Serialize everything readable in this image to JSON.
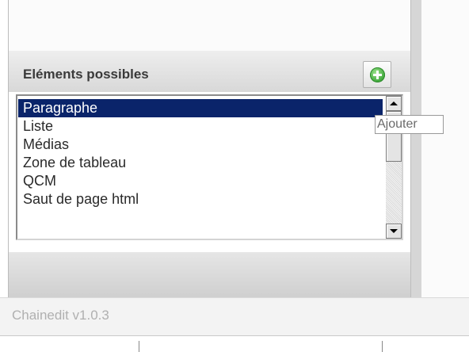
{
  "panel": {
    "header_title": "Eléments possibles",
    "add_button_icon": "plus-circle-icon",
    "list": {
      "selected_index": 0,
      "items": [
        {
          "label": "Paragraphe"
        },
        {
          "label": "Liste"
        },
        {
          "label": "Médias"
        },
        {
          "label": "Zone de tableau"
        },
        {
          "label": "QCM"
        },
        {
          "label": "Saut de page html"
        }
      ]
    }
  },
  "tooltip": {
    "text": "Ajouter"
  },
  "footer": {
    "version": "Chainedit v1.0.3"
  },
  "colors": {
    "selection": "#0a246a",
    "add_icon": "#3da63a"
  }
}
